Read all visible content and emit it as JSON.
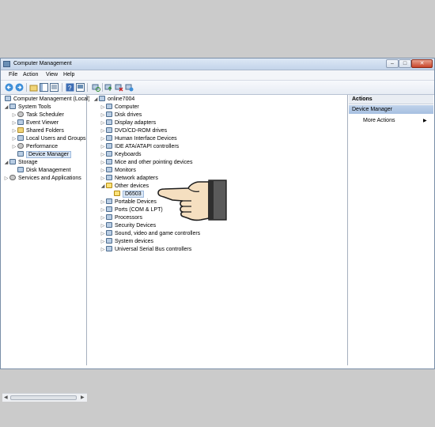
{
  "window": {
    "title": "Computer Management"
  },
  "menu": [
    "File",
    "Action",
    "View",
    "Help"
  ],
  "left_tree": {
    "root": "Computer Management (Local)",
    "system_tools": "System Tools",
    "system_tools_items": [
      "Task Scheduler",
      "Event Viewer",
      "Shared Folders",
      "Local Users and Groups",
      "Performance",
      "Device Manager"
    ],
    "storage": "Storage",
    "storage_items": [
      "Disk Management"
    ],
    "services": "Services and Applications"
  },
  "device_tree": {
    "computer_name": "online7004",
    "categories_before": [
      "Computer",
      "Disk drives",
      "Display adapters",
      "DVD/CD-ROM drives",
      "Human Interface Devices",
      "IDE ATA/ATAPI controllers",
      "Keyboards",
      "Mice and other pointing devices",
      "Monitors",
      "Network adapters"
    ],
    "other_devices": "Other devices",
    "unknown_device": "D6503",
    "categories_after": [
      "Portable Devices",
      "Ports (COM & LPT)",
      "Processors",
      "Security Devices",
      "Sound, video and game controllers",
      "System devices",
      "Universal Serial Bus controllers"
    ]
  },
  "actions": {
    "header": "Actions",
    "selected": "Device Manager",
    "more": "More Actions"
  }
}
